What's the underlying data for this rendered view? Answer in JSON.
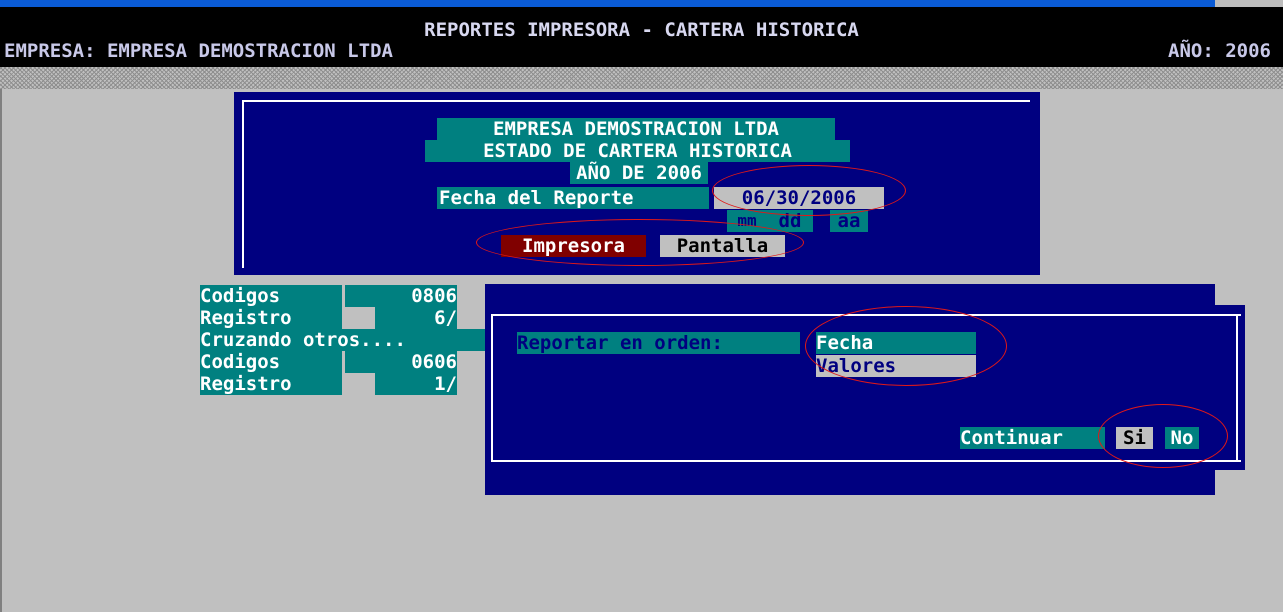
{
  "header": {
    "title": "REPORTES IMPRESORA - CARTERA HISTORICA",
    "company_label": "EMPRESA:",
    "company_name": "EMPRESA DEMOSTRACION LTDA",
    "year_label": "AÑO:",
    "year_value": "2006"
  },
  "report": {
    "company": "EMPRESA DEMOSTRACION LTDA",
    "subtitle": "ESTADO DE CARTERA HISTORICA",
    "year_text": "AÑO DE 2006",
    "date_label": "Fecha del Reporte",
    "date_value": "06/30/2006",
    "date_hint_mm": "mm",
    "date_hint_dd": "dd",
    "date_hint_aa": "aa",
    "output_options": [
      "Impresora",
      "Pantalla"
    ],
    "output_selected": "Impresora"
  },
  "progress": [
    {
      "label": "Codigos",
      "value": "0806"
    },
    {
      "label": "Registro",
      "value": "6/"
    },
    {
      "label": "Cruzando otros....",
      "value": ""
    },
    {
      "label": "Codigos",
      "value": "0606"
    },
    {
      "label": "Registro",
      "value": "1/"
    }
  ],
  "dialog": {
    "order_label": "Reportar en orden:",
    "order_options": [
      "Fecha",
      "Valores"
    ],
    "order_selected": "Fecha",
    "continue_label": "Continuar",
    "yes_label": "Si",
    "no_label": "No"
  },
  "colors": {
    "panel": "#000080",
    "highlight": "#008080",
    "selected_output": "#800000",
    "option_inactive": "#c0c0c0",
    "annotation": "#e01818"
  }
}
